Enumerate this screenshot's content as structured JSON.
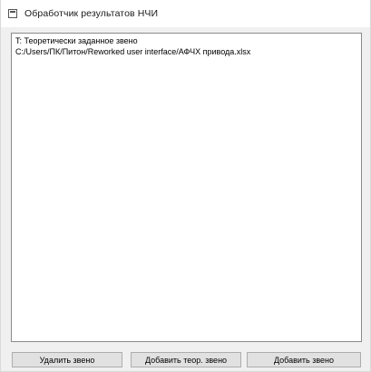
{
  "window": {
    "title": "Обработчик результатов НЧИ",
    "icon": "app-window-icon"
  },
  "listbox": {
    "items": [
      "T: Теоретически заданное звено",
      "C:/Users/ПК/Питон/Reworked user interface/АФЧХ привода.xlsx"
    ]
  },
  "buttons": {
    "delete_label": "Удалить звено",
    "add_theor_label": "Добавить теор. звено",
    "add_label": "Добавить звено"
  }
}
